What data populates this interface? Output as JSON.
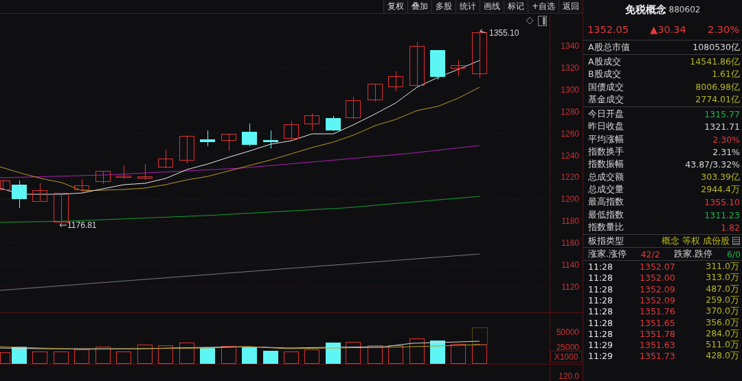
{
  "toolbar": [
    {
      "label": "复权"
    },
    {
      "label": "叠加"
    },
    {
      "label": "多股"
    },
    {
      "label": "统计"
    },
    {
      "label": "画线"
    },
    {
      "label": "标记"
    },
    {
      "label": "+自选"
    },
    {
      "label": "返回"
    }
  ],
  "chart": {
    "price_axis": [
      "1340",
      "1320",
      "1300",
      "1280",
      "1260",
      "1240",
      "1220",
      "1200",
      "1180",
      "1160",
      "1140",
      "1120"
    ],
    "high_label": "1355.10",
    "low_label": "1176.81",
    "volume_axis": [
      "50000",
      "25000"
    ],
    "volume_unit": "X1000",
    "lower_axis": [
      "120.0"
    ]
  },
  "quote": {
    "name": "免税概念",
    "code": "880602",
    "price": "1352.05",
    "change": "▲30.34",
    "change_pct": "2.30%"
  },
  "stats": [
    [
      {
        "label": "A股总市值",
        "value": "1080530亿",
        "kind": "neutral"
      }
    ],
    [
      {
        "label": "A股成交",
        "value": "14541.86亿",
        "kind": "amount"
      },
      {
        "label": "B股成交",
        "value": "1.61亿",
        "kind": "amount"
      },
      {
        "label": "国债成交",
        "value": "8006.98亿",
        "kind": "amount"
      },
      {
        "label": "基金成交",
        "value": "2774.01亿",
        "kind": "amount"
      }
    ],
    [
      {
        "label": "今日开盘",
        "value": "1315.77",
        "kind": "fall"
      },
      {
        "label": "昨日收盘",
        "value": "1321.71",
        "kind": "neutral"
      },
      {
        "label": "平均涨幅",
        "value": "2.30%",
        "kind": "rise"
      },
      {
        "label": "指数换手",
        "value": "2.31%",
        "kind": "neutral"
      },
      {
        "label": "指数振幅",
        "value": "43.87/3.32%",
        "kind": "neutral"
      },
      {
        "label": "总成交额",
        "value": "303.39亿",
        "kind": "amount"
      },
      {
        "label": "总成交量",
        "value": "2944.4万",
        "kind": "amount"
      },
      {
        "label": "最高指数",
        "value": "1355.10",
        "kind": "rise"
      },
      {
        "label": "最低指数",
        "value": "1311.23",
        "kind": "fall"
      },
      {
        "label": "指数量比",
        "value": "1.82",
        "kind": "rise"
      }
    ]
  ],
  "board_type": {
    "label": "板指类型",
    "tags": [
      "概念",
      "等权",
      "成份股"
    ]
  },
  "breadth": {
    "up_label": "涨家.涨停",
    "up": "42/2",
    "down_label": "跌家.跌停",
    "down": "6/0"
  },
  "ticks": [
    {
      "time": "11:28",
      "price": "1352.07",
      "volume": "311.0万"
    },
    {
      "time": "11:28",
      "price": "1352.00",
      "volume": "313.0万"
    },
    {
      "time": "11:28",
      "price": "1352.09",
      "volume": "487.0万"
    },
    {
      "time": "11:28",
      "price": "1352.09",
      "volume": "259.0万"
    },
    {
      "time": "11:28",
      "price": "1351.76",
      "volume": "370.0万"
    },
    {
      "time": "11:28",
      "price": "1351.65",
      "volume": "356.0万"
    },
    {
      "time": "11:28",
      "price": "1351.78",
      "volume": "284.0万"
    },
    {
      "time": "11:29",
      "price": "1351.63",
      "volume": "511.0万"
    },
    {
      "time": "11:29",
      "price": "1351.73",
      "volume": "428.0万"
    }
  ]
}
